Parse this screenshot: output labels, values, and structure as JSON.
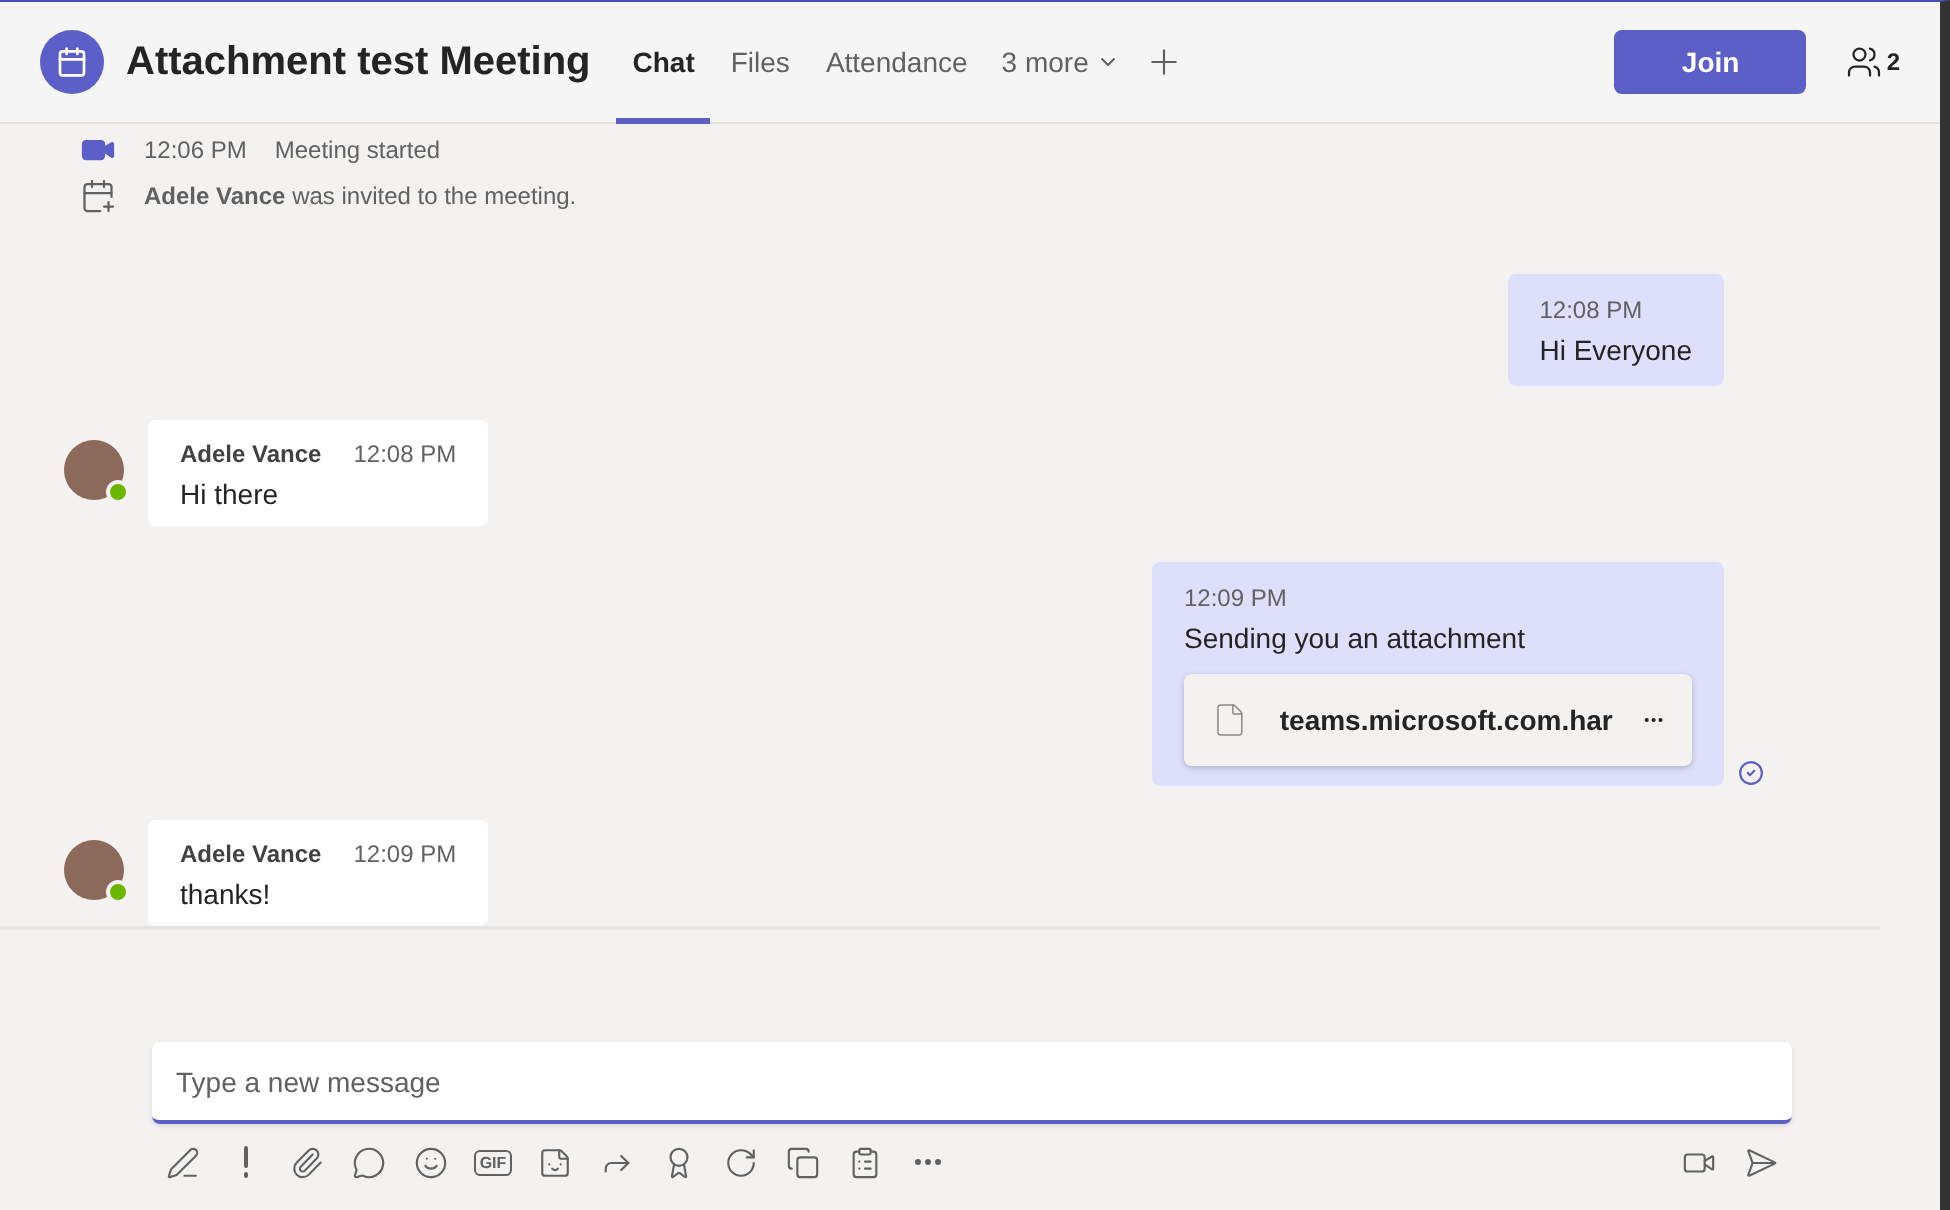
{
  "header": {
    "title": "Attachment test Meeting",
    "tabs": [
      {
        "label": "Chat",
        "selected": true
      },
      {
        "label": "Files",
        "selected": false
      },
      {
        "label": "Attendance",
        "selected": false
      }
    ],
    "more_tabs": "3 more",
    "join_button": "Join",
    "participants_count": "2"
  },
  "events": [
    {
      "kind": "meeting-started",
      "time": "12:06 PM",
      "text": "Meeting started"
    },
    {
      "kind": "invited",
      "name": "Adele Vance",
      "text": "was invited to the meeting."
    }
  ],
  "messages": [
    {
      "kind": "outgoing",
      "time": "12:08 PM",
      "text": "Hi Everyone",
      "seen": false
    },
    {
      "kind": "incoming",
      "sender": "Adele Vance",
      "color": "#6bb700",
      "time": "12:08 PM",
      "text": "Hi there"
    },
    {
      "kind": "outgoing",
      "time": "12:09 PM",
      "text": "Sending you an attachment",
      "attachment": "teams.microsoft.com.har",
      "seen": true
    },
    {
      "kind": "incoming",
      "sender": "Adele Vance",
      "color": "#6bb700",
      "time": "12:09 PM",
      "text": "thanks!"
    }
  ],
  "composer": {
    "placeholder": "Type a new message",
    "tools": [
      {
        "kind": "format"
      },
      {
        "kind": "important"
      },
      {
        "kind": "attach"
      },
      {
        "kind": "loop"
      },
      {
        "kind": "emoji"
      },
      {
        "kind": "gif",
        "label": "GIF"
      },
      {
        "kind": "sticker"
      },
      {
        "kind": "schedule"
      },
      {
        "kind": "praise"
      },
      {
        "kind": "updates"
      },
      {
        "kind": "apps"
      },
      {
        "kind": "forms"
      },
      {
        "kind": "more"
      }
    ],
    "right_tools": [
      {
        "kind": "video-clip"
      },
      {
        "kind": "send"
      }
    ]
  }
}
